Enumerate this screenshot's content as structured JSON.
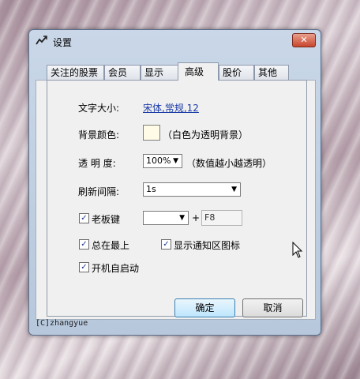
{
  "window": {
    "title": "设置"
  },
  "tabs": [
    {
      "label": "关注的股票"
    },
    {
      "label": "会员"
    },
    {
      "label": "显示"
    },
    {
      "label": "高级",
      "active": true
    },
    {
      "label": "股价图"
    },
    {
      "label": "其他"
    }
  ],
  "settings": {
    "font_label": "文字大小:",
    "font_value": "宋体,常规,12",
    "bgcolor_label": "背景颜色:",
    "bgcolor_hint": "（白色为透明背景）",
    "bgcolor_value": "#fffbe6",
    "opacity_label": "透 明 度:",
    "opacity_value": "100%",
    "opacity_hint": "（数值越小越透明）",
    "refresh_label": "刷新间隔:",
    "refresh_value": "1s",
    "boss_key_label": "老板键",
    "boss_key_checked": true,
    "boss_key_modifier": "",
    "boss_key_plus": "+",
    "boss_key_key": "F8",
    "always_on_top_label": "总在最上",
    "always_on_top_checked": true,
    "tray_icon_label": "显示通知区图标",
    "tray_icon_checked": true,
    "autostart_label": "开机自启动",
    "autostart_checked": true
  },
  "buttons": {
    "ok": "确定",
    "cancel": "取消"
  },
  "footer": {
    "credit": "[C]zhangyue"
  },
  "checkmark": "✓",
  "arrow": "▼"
}
